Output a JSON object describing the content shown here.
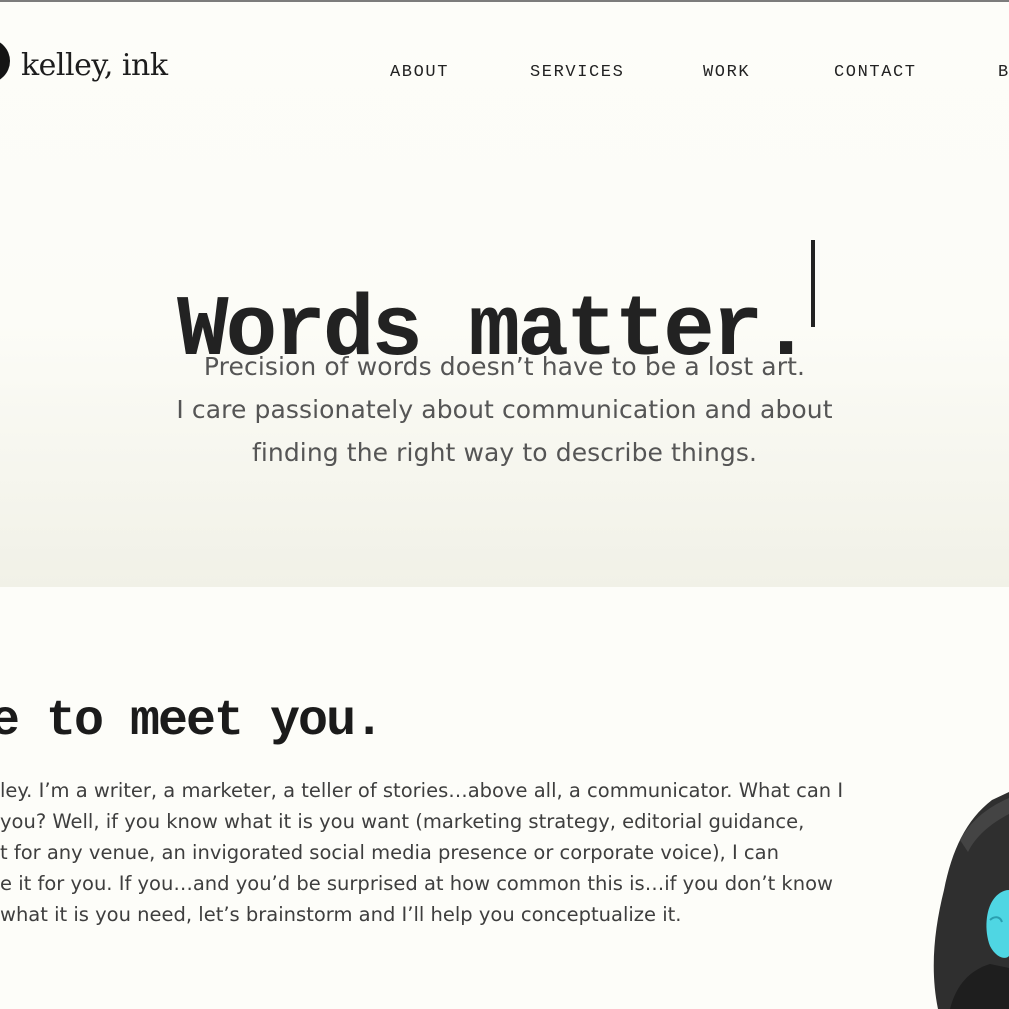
{
  "header": {
    "logo_text": "kelley, ink",
    "nav": [
      "ABOUT",
      "SERVICES",
      "WORK",
      "CONTACT",
      "B"
    ]
  },
  "hero": {
    "headline": "Words matter.",
    "lines": [
      "Precision of words doesn’t have to be a lost art.",
      "I care passionately about communication and about",
      "finding the right way to describe things."
    ]
  },
  "intro": {
    "title": "ce to meet you.",
    "paragraph_lines": [
      "ley. I’m a writer, a marketer, a teller of stories…above all, a communicator. What can I",
      "you? Well, if you know what it is you want (marketing strategy, editorial guidance,",
      "t for any venue, an invigorated social media presence or corporate voice), I can",
      "e it for you. If you…and you’d be surprised at how common this is…if you don’t know",
      "what it is you need, let’s brainstorm and I’ll help you conceptualize it."
    ]
  },
  "colors": {
    "background": "#fdfdf9",
    "text_dark": "#222222",
    "text_body": "#555555",
    "photo_accent": "#4fd6e3"
  }
}
